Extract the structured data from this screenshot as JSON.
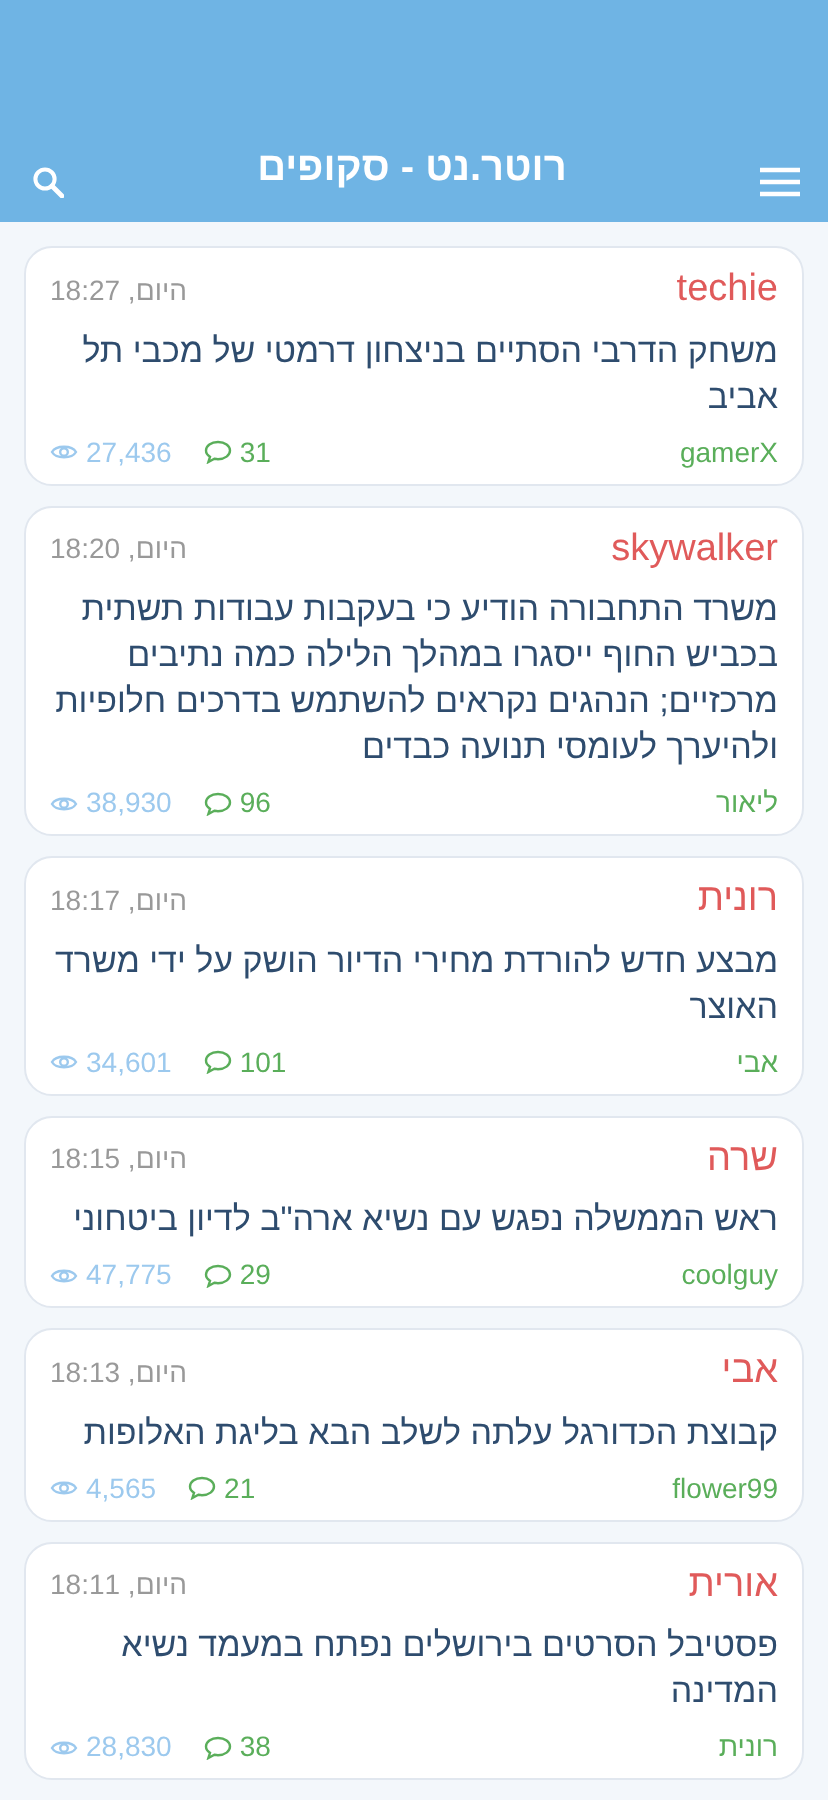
{
  "header": {
    "title": "רוטר.נט - סקופים"
  },
  "posts": [
    {
      "author": "techie",
      "time": "היום, 18:27",
      "headline": "משחק הדרבי הסתיים בניצחון דרמטי של מכבי תל אביב",
      "user": "gamerX",
      "views": "27,436",
      "comments": "31"
    },
    {
      "author": "skywalker",
      "time": "היום, 18:20",
      "headline": "משרד התחבורה הודיע כי בעקבות עבודות תשתית בכביש החוף ייסגרו במהלך הלילה כמה נתיבים מרכזיים; הנהגים נקראים להשתמש בדרכים חלופיות ולהיערך לעומסי תנועה כבדים",
      "user": "ליאור",
      "views": "38,930",
      "comments": "96"
    },
    {
      "author": "רונית",
      "time": "היום, 18:17",
      "headline": "מבצע חדש להורדת מחירי הדיור הושק על ידי משרד האוצר",
      "user": "אבי",
      "views": "34,601",
      "comments": "101"
    },
    {
      "author": "שרה",
      "time": "היום, 18:15",
      "headline": "ראש הממשלה נפגש עם נשיא ארה\"ב לדיון ביטחוני",
      "user": "coolguy",
      "views": "47,775",
      "comments": "29"
    },
    {
      "author": "אבי",
      "time": "היום, 18:13",
      "headline": "קבוצת הכדורגל עלתה לשלב הבא בליגת האלופות",
      "user": "flower99",
      "views": "4,565",
      "comments": "21"
    },
    {
      "author": "אורית",
      "time": "היום, 18:11",
      "headline": "פסטיבל הסרטים בירושלים נפתח במעמד נשיא המדינה",
      "user": "רונית",
      "views": "28,830",
      "comments": "38"
    }
  ]
}
